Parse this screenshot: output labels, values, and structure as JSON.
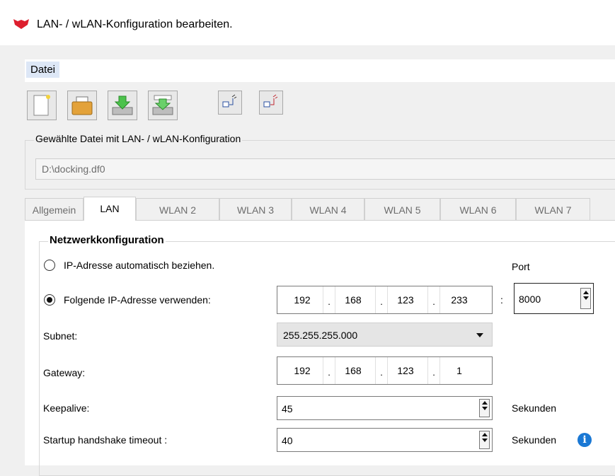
{
  "window": {
    "title": "LAN- / wLAN-Konfiguration bearbeiten."
  },
  "menu": {
    "items": [
      {
        "label": "Datei"
      }
    ]
  },
  "toolbar": {
    "buttons": [
      "new-file-icon",
      "open-folder-icon",
      "load-drive-icon",
      "save-drive-icon",
      "network-send-icon",
      "network-receive-icon"
    ]
  },
  "file_group": {
    "legend": "Gewählte Datei mit LAN- / wLAN-Konfiguration",
    "path": "D:\\docking.df0"
  },
  "tabs": [
    {
      "label": "Allgemein",
      "active": false
    },
    {
      "label": "LAN",
      "active": true
    },
    {
      "label": "WLAN 2",
      "active": false
    },
    {
      "label": "WLAN 3",
      "active": false
    },
    {
      "label": "WLAN 4",
      "active": false
    },
    {
      "label": "WLAN 5",
      "active": false
    },
    {
      "label": "WLAN 6",
      "active": false
    },
    {
      "label": "WLAN 7",
      "active": false
    }
  ],
  "network": {
    "legend": "Netzwerkkonfiguration",
    "auto_label": "IP-Adresse automatisch beziehen.",
    "manual_label": "Folgende IP-Adresse verwenden:",
    "selected": "manual",
    "ip": [
      "192",
      "168",
      "123",
      "233"
    ],
    "port_label": "Port",
    "port_sep": ":",
    "port": "8000",
    "subnet_label": "Subnet:",
    "subnet": "255.255.255.000",
    "gateway_label": "Gateway:",
    "gateway": [
      "192",
      "168",
      "123",
      "1"
    ],
    "keepalive_label": "Keepalive:",
    "keepalive": "45",
    "keepalive_unit": "Sekunden",
    "handshake_label": "Startup handshake timeout :",
    "handshake": "40",
    "handshake_unit": "Sekunden",
    "dot": "."
  },
  "colors": {
    "accent": "#dd1f2e",
    "info": "#1a78d4",
    "menu_highlight": "#dde7f6"
  }
}
